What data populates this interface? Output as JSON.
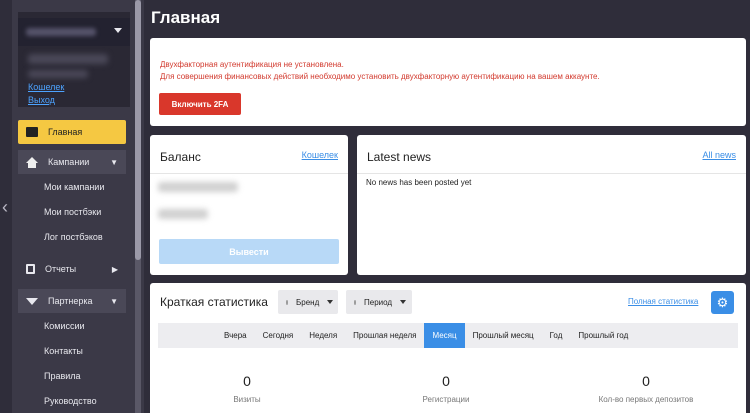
{
  "page": {
    "title": "Главная"
  },
  "sidebar": {
    "account": {
      "wallet_link": "Кошелек",
      "logout_link": "Выход"
    },
    "items": [
      {
        "label": "Главная",
        "icon": "card-icon",
        "active": true
      },
      {
        "label": "Кампании",
        "icon": "home-icon",
        "expanded": true,
        "children": [
          "Мои кампании",
          "Мои постбэки",
          "Лог постбэков"
        ]
      },
      {
        "label": "Отчеты",
        "icon": "clipboard-icon"
      },
      {
        "label": "Партнерка",
        "icon": "triangle-icon",
        "expanded": true,
        "children": [
          "Комиссии",
          "Контакты",
          "Правила",
          "Руководство"
        ]
      }
    ]
  },
  "alert": {
    "line1": "Двухфакторная аутентификация не установлена.",
    "line2": "Для совершения финансовых действий необходимо установить двухфакторную аутентификацию на вашем аккаунте.",
    "button": "Включить 2FA"
  },
  "balance": {
    "title": "Баланс",
    "link": "Кошелек",
    "withdraw": "Вывести"
  },
  "news": {
    "title": "Latest news",
    "link": "All news",
    "empty": "No news has been posted yet"
  },
  "stats": {
    "title": "Краткая статистика",
    "brand_dropdown": "Бренд",
    "period_dropdown": "Период",
    "full_link": "Полная статистика",
    "tabs": [
      "Вчера",
      "Сегодня",
      "Неделя",
      "Прошлая неделя",
      "Месяц",
      "Прошлый месяц",
      "Год",
      "Прошлый год"
    ],
    "active_tab": "Месяц",
    "kpis": [
      {
        "value": "0",
        "label": "Визиты"
      },
      {
        "value": "0",
        "label": "Регистрации"
      },
      {
        "value": "0",
        "label": "Кол-во первых депозитов"
      }
    ]
  },
  "colors": {
    "accent": "#3a8ee6",
    "active_menu": "#f5c842",
    "alert": "#d9372b"
  }
}
